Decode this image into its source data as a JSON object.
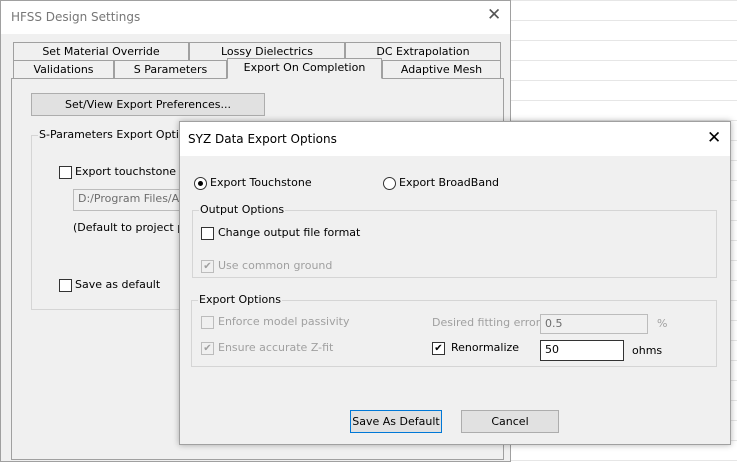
{
  "main_dialog": {
    "title": "HFSS Design Settings",
    "tabs_row1": [
      "Set Material Override",
      "Lossy Dielectrics",
      "DC Extrapolation"
    ],
    "tabs_row2": [
      "Validations",
      "S Parameters",
      "Export On Completion",
      "Adaptive Mesh"
    ],
    "active_tab": "Export On Completion",
    "set_view_button": "Set/View Export Preferences...",
    "group_label": "S-Parameters Export Options",
    "export_touchstone_label": "Export touchstone file",
    "export_touchstone_checked": false,
    "path_value": "D:/Program Files/AnsysEM",
    "default_note": "(Default to project path)",
    "save_default_label": "Save as default",
    "save_default_checked": false
  },
  "syz_dialog": {
    "title": "SYZ Data Export Options",
    "radio_touchstone": "Export Touchstone",
    "radio_broadband": "Export BroadBand",
    "selected": "Export Touchstone",
    "output_group": "Output Options",
    "change_format_label": "Change output file format",
    "change_format_checked": false,
    "common_ground_label": "Use common ground",
    "common_ground_checked": true,
    "export_group": "Export Options",
    "passivity_label": "Enforce model passivity",
    "passivity_checked": false,
    "zfit_label": "Ensure accurate Z-fit",
    "zfit_checked": true,
    "fitting_error_label": "Desired fitting error:",
    "fitting_error_value": "0.5",
    "fitting_error_unit": "%",
    "renormalize_label": "Renormalize",
    "renormalize_checked": true,
    "renormalize_value": "50",
    "renormalize_unit": "ohms",
    "save_default_button": "Save As Default",
    "cancel_button": "Cancel"
  }
}
